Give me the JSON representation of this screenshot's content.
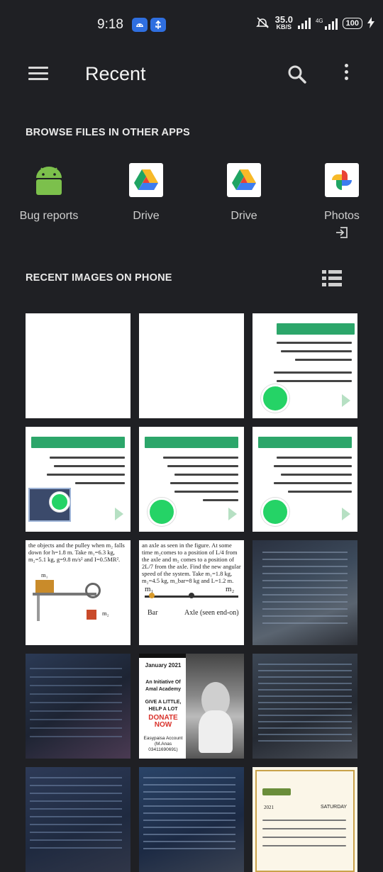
{
  "status_bar": {
    "time": "9:18",
    "net_speed_value": "35.0",
    "net_speed_unit": "KB/S",
    "network_label": "4G",
    "battery": "100"
  },
  "header": {
    "title": "Recent"
  },
  "browse": {
    "heading": "BROWSE FILES IN OTHER APPS",
    "apps": [
      {
        "label": "Bug reports",
        "icon": "android-icon"
      },
      {
        "label": "Drive",
        "icon": "google-drive-icon"
      },
      {
        "label": "Drive",
        "icon": "google-drive-icon"
      },
      {
        "label": "Photos",
        "icon": "google-photos-icon"
      }
    ]
  },
  "recent": {
    "heading": "RECENT IMAGES ON PHONE"
  },
  "thumbnails": {
    "physics1_body": "the objects and the pulley when m₂ falls down for h=1.8 m. Take m₁=6.3 kg, m₂=5.1 kg, g=9.8 m/s² and I=0.5MR².",
    "physics1_m1": "m₁",
    "physics1_m2": "m₂",
    "physics2_body": "an axle as seen in the figure. At some time m₂comes to a position of L/4 from the axle and m₂ comes to a position of 2L/7 from the axle. Find the new angular speed of the system. Take m₁=1.8 kg, m₂=4.5 kg, m_bar=8 kg and L=1.2 m.",
    "physics2_m1": "m₁",
    "physics2_m2": "m₂",
    "physics2_bar": "Bar",
    "physics2_axle": "Axle (seen end-on)",
    "poster_date": "January 2021",
    "poster_initiative": "An Initiative Of Amal Academy",
    "poster_give": "GIVE A LITTLE, HELP A LOT",
    "poster_donate": "DONATE NOW",
    "poster_account": "Easypaisa Account (M.Anas 03411690691)",
    "calendar_day": "SATURDAY",
    "calendar_year": "2021"
  },
  "colors": {
    "background": "#1f2024",
    "whatsapp_green": "#25d366",
    "card_green": "#2ca66a"
  }
}
